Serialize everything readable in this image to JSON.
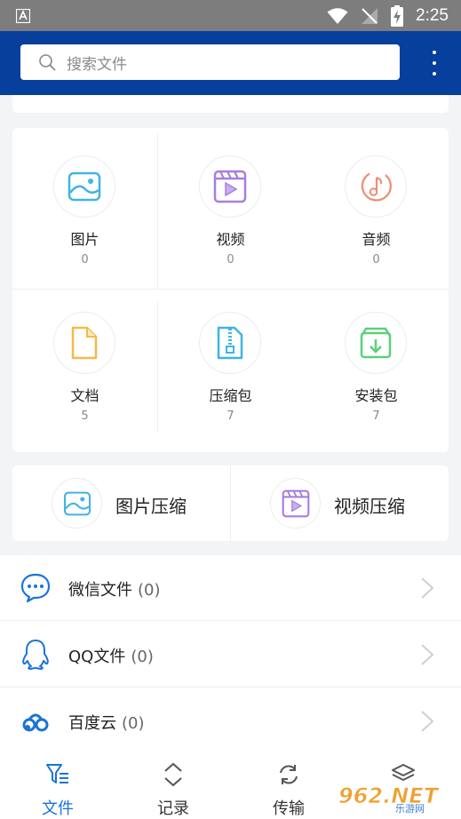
{
  "status_bar": {
    "time": "2:25"
  },
  "header": {
    "search_placeholder": "搜索文件"
  },
  "categories": [
    {
      "name": "图片",
      "count": "0"
    },
    {
      "name": "视频",
      "count": "0"
    },
    {
      "name": "音频",
      "count": "0"
    },
    {
      "name": "文档",
      "count": "5"
    },
    {
      "name": "压缩包",
      "count": "7"
    },
    {
      "name": "安装包",
      "count": "7"
    }
  ],
  "compress": [
    {
      "label": "图片压缩"
    },
    {
      "label": "视频压缩"
    }
  ],
  "sources": [
    {
      "label": "微信文件",
      "count": "(0)"
    },
    {
      "label": "QQ文件",
      "count": "(0)"
    },
    {
      "label": "百度云",
      "count": "(0)"
    }
  ],
  "bottom_nav": [
    {
      "label": "文件",
      "active": true
    },
    {
      "label": "记录"
    },
    {
      "label": "传输"
    },
    {
      "label": ""
    }
  ],
  "colors": {
    "header": "#063f9c",
    "accent": "#1a73d9",
    "image_icon": "#3fb4e5",
    "video_icon": "#a77ee0",
    "audio_icon": "#ee8c70",
    "doc_icon": "#f2b94e",
    "zip_icon": "#3fb4e5",
    "apk_icon": "#5ccf7b"
  },
  "watermark": {
    "text": "962.NET",
    "sub": "乐游网"
  }
}
